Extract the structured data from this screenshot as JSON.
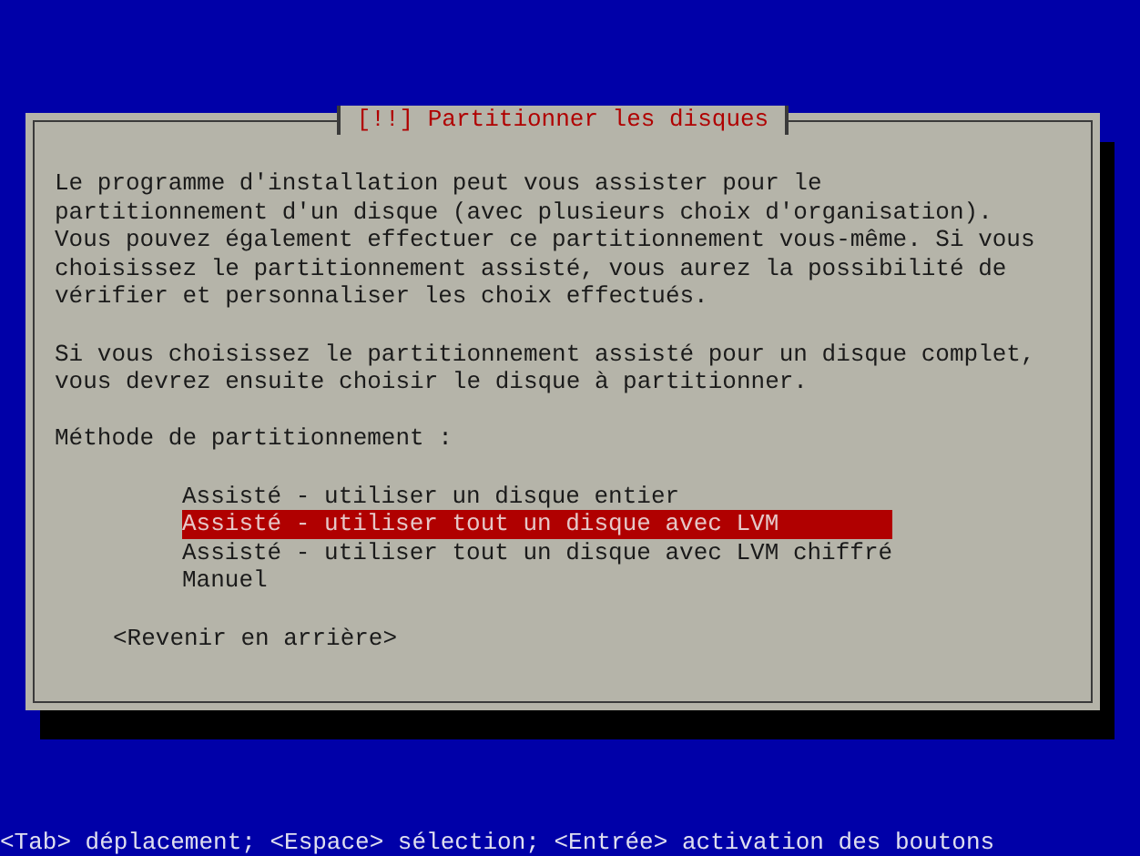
{
  "dialog": {
    "title": "[!!] Partitionner les disques",
    "paragraphs": [
      "Le programme d'installation peut vous assister pour le\npartitionnement d'un disque (avec plusieurs choix d'organisation).\nVous pouvez également effectuer ce partitionnement vous-même. Si vous\nchoisissez le partitionnement assisté, vous aurez la possibilité de\nvérifier et personnaliser les choix effectués.",
      "Si vous choisissez le partitionnement assisté pour un disque complet,\nvous devrez ensuite choisir le disque à partitionner."
    ],
    "prompt": "Méthode de partitionnement :",
    "options": [
      {
        "label": "Assisté - utiliser un disque entier",
        "selected": false
      },
      {
        "label": "Assisté - utiliser tout un disque avec LVM",
        "selected": true
      },
      {
        "label": "Assisté - utiliser tout un disque avec LVM chiffré",
        "selected": false
      },
      {
        "label": "Manuel",
        "selected": false
      }
    ],
    "back_button": "<Revenir en arrière>"
  },
  "status_bar": "<Tab> déplacement; <Espace> sélection; <Entrée> activation des boutons"
}
